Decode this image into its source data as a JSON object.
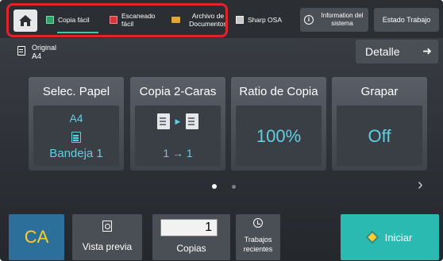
{
  "topbar": {
    "items": [
      {
        "label": "Copia fácil",
        "icon": "copy-icon"
      },
      {
        "label": "Escaneado fácil",
        "icon": "scan-icon"
      },
      {
        "label": "Archivo de Documentos",
        "icon": "folder-icon"
      },
      {
        "label": "Sharp OSA",
        "icon": "osa-icon"
      }
    ],
    "info_label": "Information del sistema",
    "status_label": "Estado Trabajo",
    "home_icon": "home-icon",
    "highlight_color": "#e0242c"
  },
  "original": {
    "label": "Original",
    "value": "A4",
    "details_label": "Detalle"
  },
  "tiles": [
    {
      "title": "Selec. Papel",
      "line1": "A4",
      "line2": "Bandeja 1"
    },
    {
      "title": "Copia 2-Caras",
      "line2": "1 → 1"
    },
    {
      "title": "Ratio de Copia",
      "big": "100%"
    },
    {
      "title": "Grapar",
      "big": "Off"
    }
  ],
  "pager": {
    "pages": 2,
    "current": 1
  },
  "bottom": {
    "ca_label": "CA",
    "preview_label": "Vista previa",
    "copies_value": "1",
    "copies_label": "Copias",
    "recent_label": "Trabajos recientes",
    "start_label": "Iniciar"
  },
  "colors": {
    "accent_teal": "#2bbab1",
    "value_cyan": "#5fd0e4",
    "ca_blue": "#2c6f9a",
    "ca_text": "#ffcc33"
  }
}
